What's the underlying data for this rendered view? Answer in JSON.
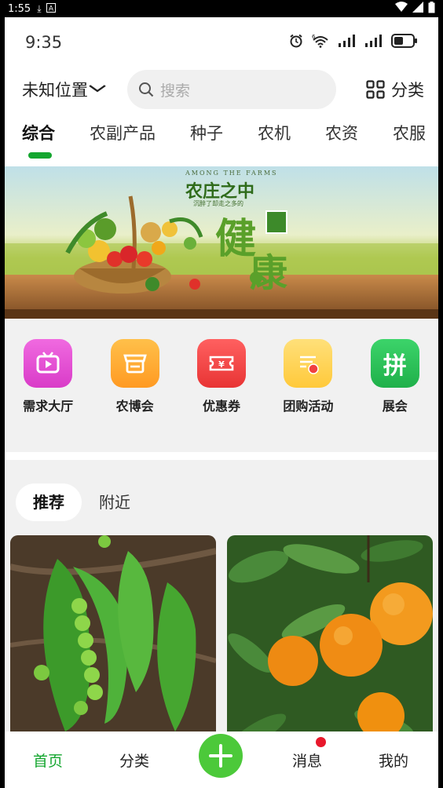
{
  "system_bar": {
    "time": "1:55",
    "icons": [
      "download-icon",
      "a-icon"
    ],
    "right_icons": [
      "wifi-icon",
      "signal-icon",
      "battery-icon"
    ]
  },
  "inner_status": {
    "time": "9:35",
    "icons": [
      "alarm-icon",
      "wifi6-icon",
      "signal-icon",
      "signal-icon",
      "battery-icon"
    ]
  },
  "header": {
    "location": "未知位置",
    "search_placeholder": "搜索",
    "category_label": "分类"
  },
  "tabs": [
    "综合",
    "农副产品",
    "种子",
    "农机",
    "农资",
    "农服"
  ],
  "active_tab": 0,
  "banner": {
    "en_text": "AMONG THE FARMS",
    "title": "农庄之中",
    "subtitle": "沉醉了却走之多的",
    "big_char_1": "健",
    "big_char_2": "康"
  },
  "entries": [
    {
      "label": "需求大厅",
      "icon": "tv-icon",
      "color": "#e84fd8"
    },
    {
      "label": "农博会",
      "icon": "shop-icon",
      "color": "#ffa63a"
    },
    {
      "label": "优惠券",
      "icon": "coupon-icon",
      "color": "#f24545"
    },
    {
      "label": "团购活动",
      "icon": "document-icon",
      "color": "#ffd24a"
    },
    {
      "label": "展会",
      "icon": "pin-char-icon",
      "icon_char": "拼",
      "color": "#2ec35a"
    }
  ],
  "feed": {
    "subtabs": [
      "推荐",
      "附近"
    ],
    "active_subtab": 0
  },
  "bottom_nav": {
    "items": [
      "首页",
      "分类",
      "",
      "消息",
      "我的"
    ],
    "active": 0,
    "plus_icon": "plus-icon",
    "has_message_badge": true
  },
  "colors": {
    "accent": "#14a62f",
    "plus_button": "#4cc93a",
    "badge": "#e8182b"
  }
}
